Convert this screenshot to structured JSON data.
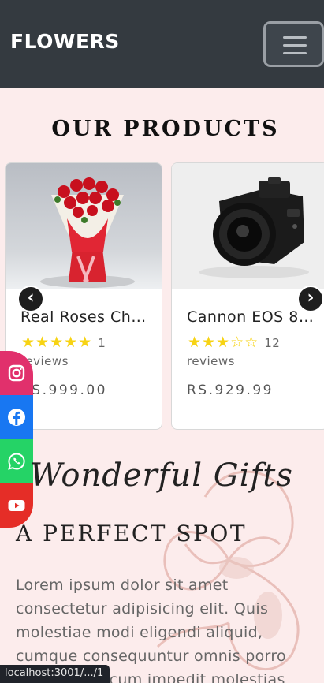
{
  "navbar": {
    "brand": "FLOWERS"
  },
  "products": {
    "title": "OUR PRODUCTS",
    "items": [
      {
        "title": "Real Roses Ch…",
        "stars": "★★★★★",
        "stars_off": "",
        "review_count": "1",
        "reviews_label": "reviews",
        "price": "RS.999.00"
      },
      {
        "title": "Cannon EOS 8…",
        "stars": "★★★",
        "stars_off": "☆☆",
        "review_count": "12",
        "reviews_label": "reviews",
        "price": "RS.929.99"
      }
    ]
  },
  "social": [
    {
      "name": "instagram-icon",
      "color": "#e1306c"
    },
    {
      "name": "facebook-icon",
      "color": "#1877f2"
    },
    {
      "name": "whatsapp-icon",
      "color": "#25d366"
    },
    {
      "name": "youtube-icon",
      "color": "#e52d27"
    }
  ],
  "gifts": {
    "script_title": "Wonderful Gifts",
    "subtitle": "A PERFECT SPOT",
    "body": "Lorem ipsum dolor sit amet consectetur adipisicing elit. Quis molestiae modi eligendi aliquid, cumque consequuntur omnis porro voluptatum cum impedit molestias"
  },
  "status_bar": {
    "url": "localhost:3001/.../1"
  }
}
